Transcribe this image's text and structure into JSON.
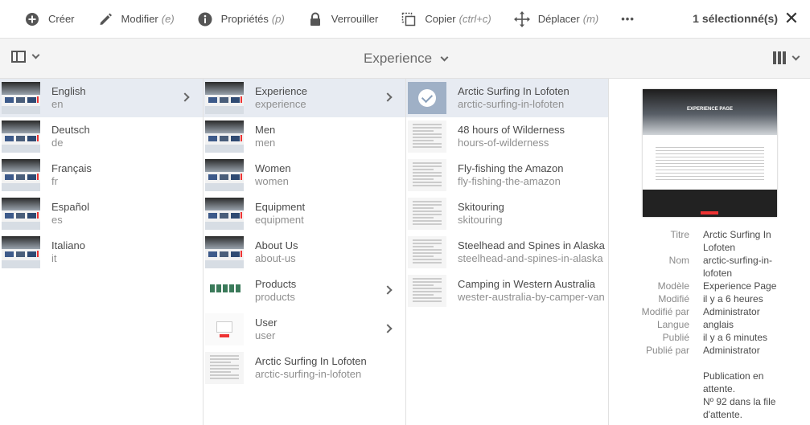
{
  "actionbar": {
    "create": "Créer",
    "modify": "Modifier",
    "modify_shortcut": "(e)",
    "properties": "Propriétés",
    "properties_shortcut": "(p)",
    "lock": "Verrouiller",
    "copy": "Copier",
    "copy_shortcut": "(ctrl+c)",
    "move": "Déplacer",
    "move_shortcut": "(m)",
    "more": "•••",
    "selection_count": "1 sélectionné(s)",
    "close": "✕"
  },
  "header": {
    "title": "Experience"
  },
  "columns": [
    {
      "items": [
        {
          "title": "English",
          "name": "en",
          "selected": true,
          "has_children": true,
          "thumb": "site"
        },
        {
          "title": "Deutsch",
          "name": "de",
          "selected": false,
          "has_children": false,
          "thumb": "site"
        },
        {
          "title": "Français",
          "name": "fr",
          "selected": false,
          "has_children": false,
          "thumb": "site"
        },
        {
          "title": "Español",
          "name": "es",
          "selected": false,
          "has_children": false,
          "thumb": "site"
        },
        {
          "title": "Italiano",
          "name": "it",
          "selected": false,
          "has_children": false,
          "thumb": "site"
        }
      ]
    },
    {
      "items": [
        {
          "title": "Experience",
          "name": "experience",
          "selected": true,
          "has_children": true,
          "thumb": "site"
        },
        {
          "title": "Men",
          "name": "men",
          "selected": false,
          "has_children": false,
          "thumb": "site"
        },
        {
          "title": "Women",
          "name": "women",
          "selected": false,
          "has_children": false,
          "thumb": "site"
        },
        {
          "title": "Equipment",
          "name": "equipment",
          "selected": false,
          "has_children": false,
          "thumb": "site"
        },
        {
          "title": "About Us",
          "name": "about-us",
          "selected": false,
          "has_children": false,
          "thumb": "site"
        },
        {
          "title": "Products",
          "name": "products",
          "selected": false,
          "has_children": true,
          "thumb": "products"
        },
        {
          "title": "User",
          "name": "user",
          "selected": false,
          "has_children": true,
          "thumb": "user"
        },
        {
          "title": "Arctic Surfing In Lofoten",
          "name": "arctic-surfing-in-lofoten",
          "selected": false,
          "has_children": false,
          "thumb": "doc"
        }
      ]
    },
    {
      "items": [
        {
          "title": "Arctic Surfing In Lofoten",
          "name": "arctic-surfing-in-lofoten",
          "selected": true,
          "has_children": false,
          "thumb": "selected"
        },
        {
          "title": "48 hours of Wilderness",
          "name": "hours-of-wilderness",
          "selected": false,
          "has_children": false,
          "thumb": "doc"
        },
        {
          "title": "Fly-fishing the Amazon",
          "name": "fly-fishing-the-amazon",
          "selected": false,
          "has_children": false,
          "thumb": "doc"
        },
        {
          "title": "Skitouring",
          "name": "skitouring",
          "selected": false,
          "has_children": false,
          "thumb": "doc"
        },
        {
          "title": "Steelhead and Spines in Alaska",
          "name": "steelhead-and-spines-in-alaska",
          "selected": false,
          "has_children": false,
          "thumb": "doc"
        },
        {
          "title": "Camping in Western Australia",
          "name": "wester-australia-by-camper-van",
          "selected": false,
          "has_children": false,
          "thumb": "doc"
        }
      ]
    }
  ],
  "preview": {
    "thumbnail_heading": "EXPERIENCE PAGE",
    "properties": [
      {
        "label": "Titre",
        "value": "Arctic Surfing In Lofoten"
      },
      {
        "label": "Nom",
        "value": "arctic-surfing-in-lofoten"
      },
      {
        "label": "Modèle",
        "value": "Experience Page"
      },
      {
        "label": "Modifié",
        "value": "il y a 6 heures"
      },
      {
        "label": "Modifié par",
        "value": "Administrator"
      },
      {
        "label": "Langue",
        "value": "anglais"
      },
      {
        "label": "Publié",
        "value": "il y a 6 minutes"
      },
      {
        "label": "Publié par",
        "value": "Administrator"
      }
    ],
    "status_note": "Publication en attente.",
    "queue_note": "Nº 92 dans la file d'attente."
  }
}
